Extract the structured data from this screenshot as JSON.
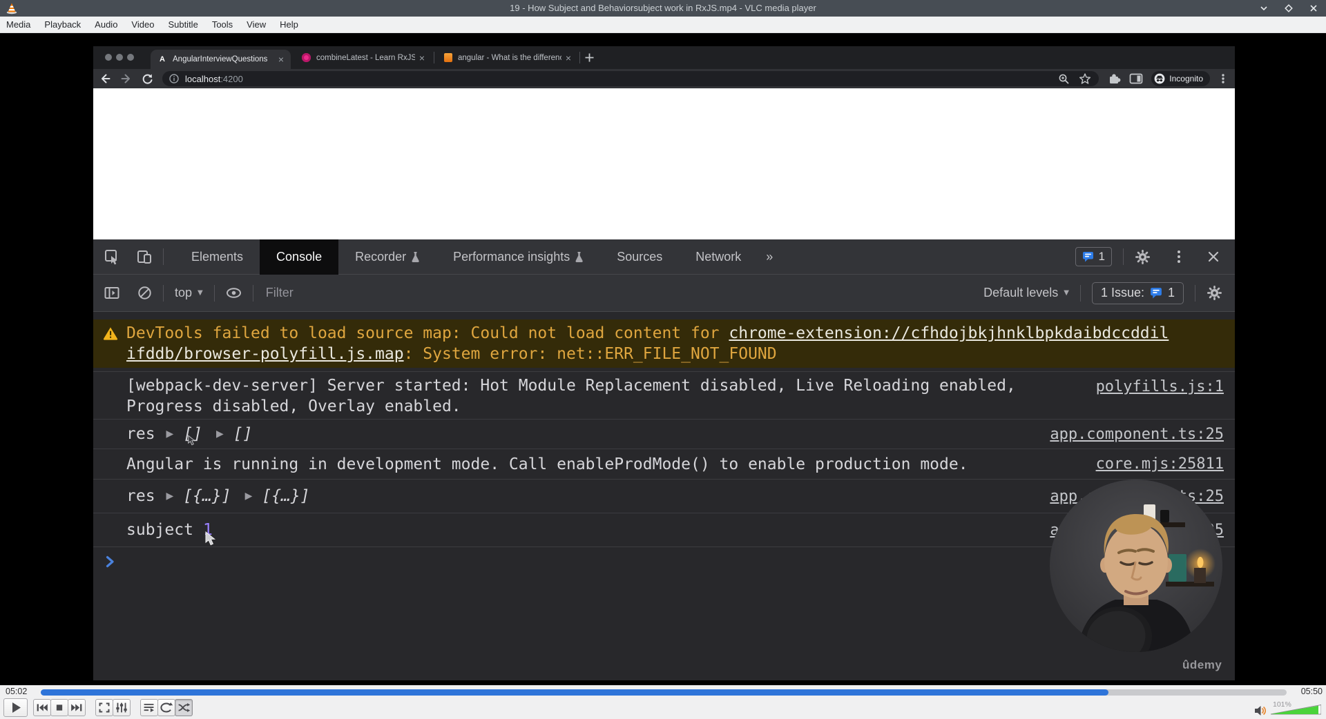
{
  "vlc": {
    "title": "19 - How Subject and Behaviorsubject work in RxJS.mp4 - VLC media player",
    "menu": [
      "Media",
      "Playback",
      "Audio",
      "Video",
      "Subtitle",
      "Tools",
      "View",
      "Help"
    ],
    "time_current": "05:02",
    "time_total": "05:50",
    "volume_percent": "101%"
  },
  "browser": {
    "tabs": [
      {
        "title": "AngularInterviewQuestions",
        "favicon_letter": "A"
      },
      {
        "title": "combineLatest - Learn RxJS"
      },
      {
        "title": "angular - What is the differenc"
      }
    ],
    "url": {
      "host": "localhost",
      "port": ":4200"
    },
    "incognito_label": "Incognito"
  },
  "devtools": {
    "tabs": [
      "Elements",
      "Console",
      "Recorder",
      "Performance insights",
      "Sources",
      "Network"
    ],
    "more_tabs_chevron": "»",
    "issues_tab_count": "1",
    "toolbar": {
      "context_label": "top",
      "filter_placeholder": "Filter",
      "levels_label": "Default levels",
      "issues_label": "1 Issue:",
      "issues_count": "1"
    },
    "console": {
      "warning": {
        "text_before_link": "DevTools failed to load source map: Could not load content for ",
        "link_line1": "chrome-extension://cfhdojbkjhnklbpkdaibdccddil",
        "link_line2": "ifddb/browser-polyfill.js.map",
        "text_after_link": ": System error: net::ERR_FILE_NOT_FOUND"
      },
      "messages": [
        {
          "line1": "[webpack-dev-server] Server started: Hot Module Replacement disabled, Live Reloading enabled,",
          "line2": "Progress disabled, Overlay enabled.",
          "source": "polyfills.js:1"
        },
        {
          "label": "res",
          "preview1": "[]",
          "preview2": "[]",
          "source": "app.component.ts:25"
        },
        {
          "text": "Angular is running in development mode. Call enableProdMode() to enable production mode.",
          "source": "core.mjs:25811"
        },
        {
          "label": "res",
          "preview1": "[{…}]",
          "preview2": "[{…}]",
          "source": "app.component.ts:25"
        },
        {
          "label": "subject",
          "value": "1",
          "source": "app.component.ts:25"
        }
      ]
    }
  },
  "icons": {
    "close_x": "×",
    "dropdown_arrow": "▼",
    "expand_arrow": "▶"
  },
  "overlay": {
    "watermark": "ûdemy"
  },
  "colors": {
    "accent_blue": "#2e7de9",
    "warning_text": "#dfa63f",
    "number_purple": "#9980ff",
    "seek_blue": "#2e74d9",
    "volume_green": "#4ad33b",
    "vlc_orange": "#ff8800"
  }
}
